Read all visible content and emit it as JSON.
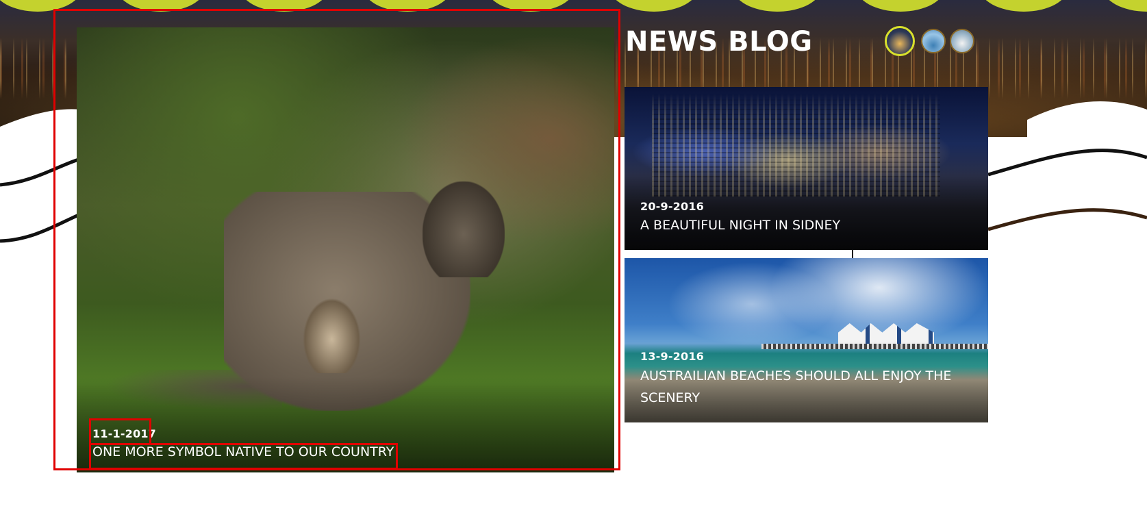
{
  "blog": {
    "title": "NEWS BLOG"
  },
  "featured_post": {
    "date": "11-1-2017",
    "title": "ONE MORE SYMBOL NATIVE TO OUR COUNTRY",
    "image": "kangaroo-with-joey"
  },
  "side_posts": [
    {
      "date": "20-9-2016",
      "title": "A BEAUTIFUL NIGHT IN SIDNEY",
      "image": "sydney-city-night"
    },
    {
      "date": "13-9-2016",
      "title": "AUSTRAILIAN BEACHES SHOULD ALL ENJOY THE SCENERY",
      "image": "beach-pier"
    }
  ],
  "header_selectors": [
    "city-night-thumb",
    "beach-thumb",
    "opera-house-thumb"
  ],
  "colors": {
    "accent_lime": "#c4d22e",
    "highlight_red": "#e00000",
    "active_selector_ring": "#d9e12c",
    "text_white": "#ffffff"
  }
}
